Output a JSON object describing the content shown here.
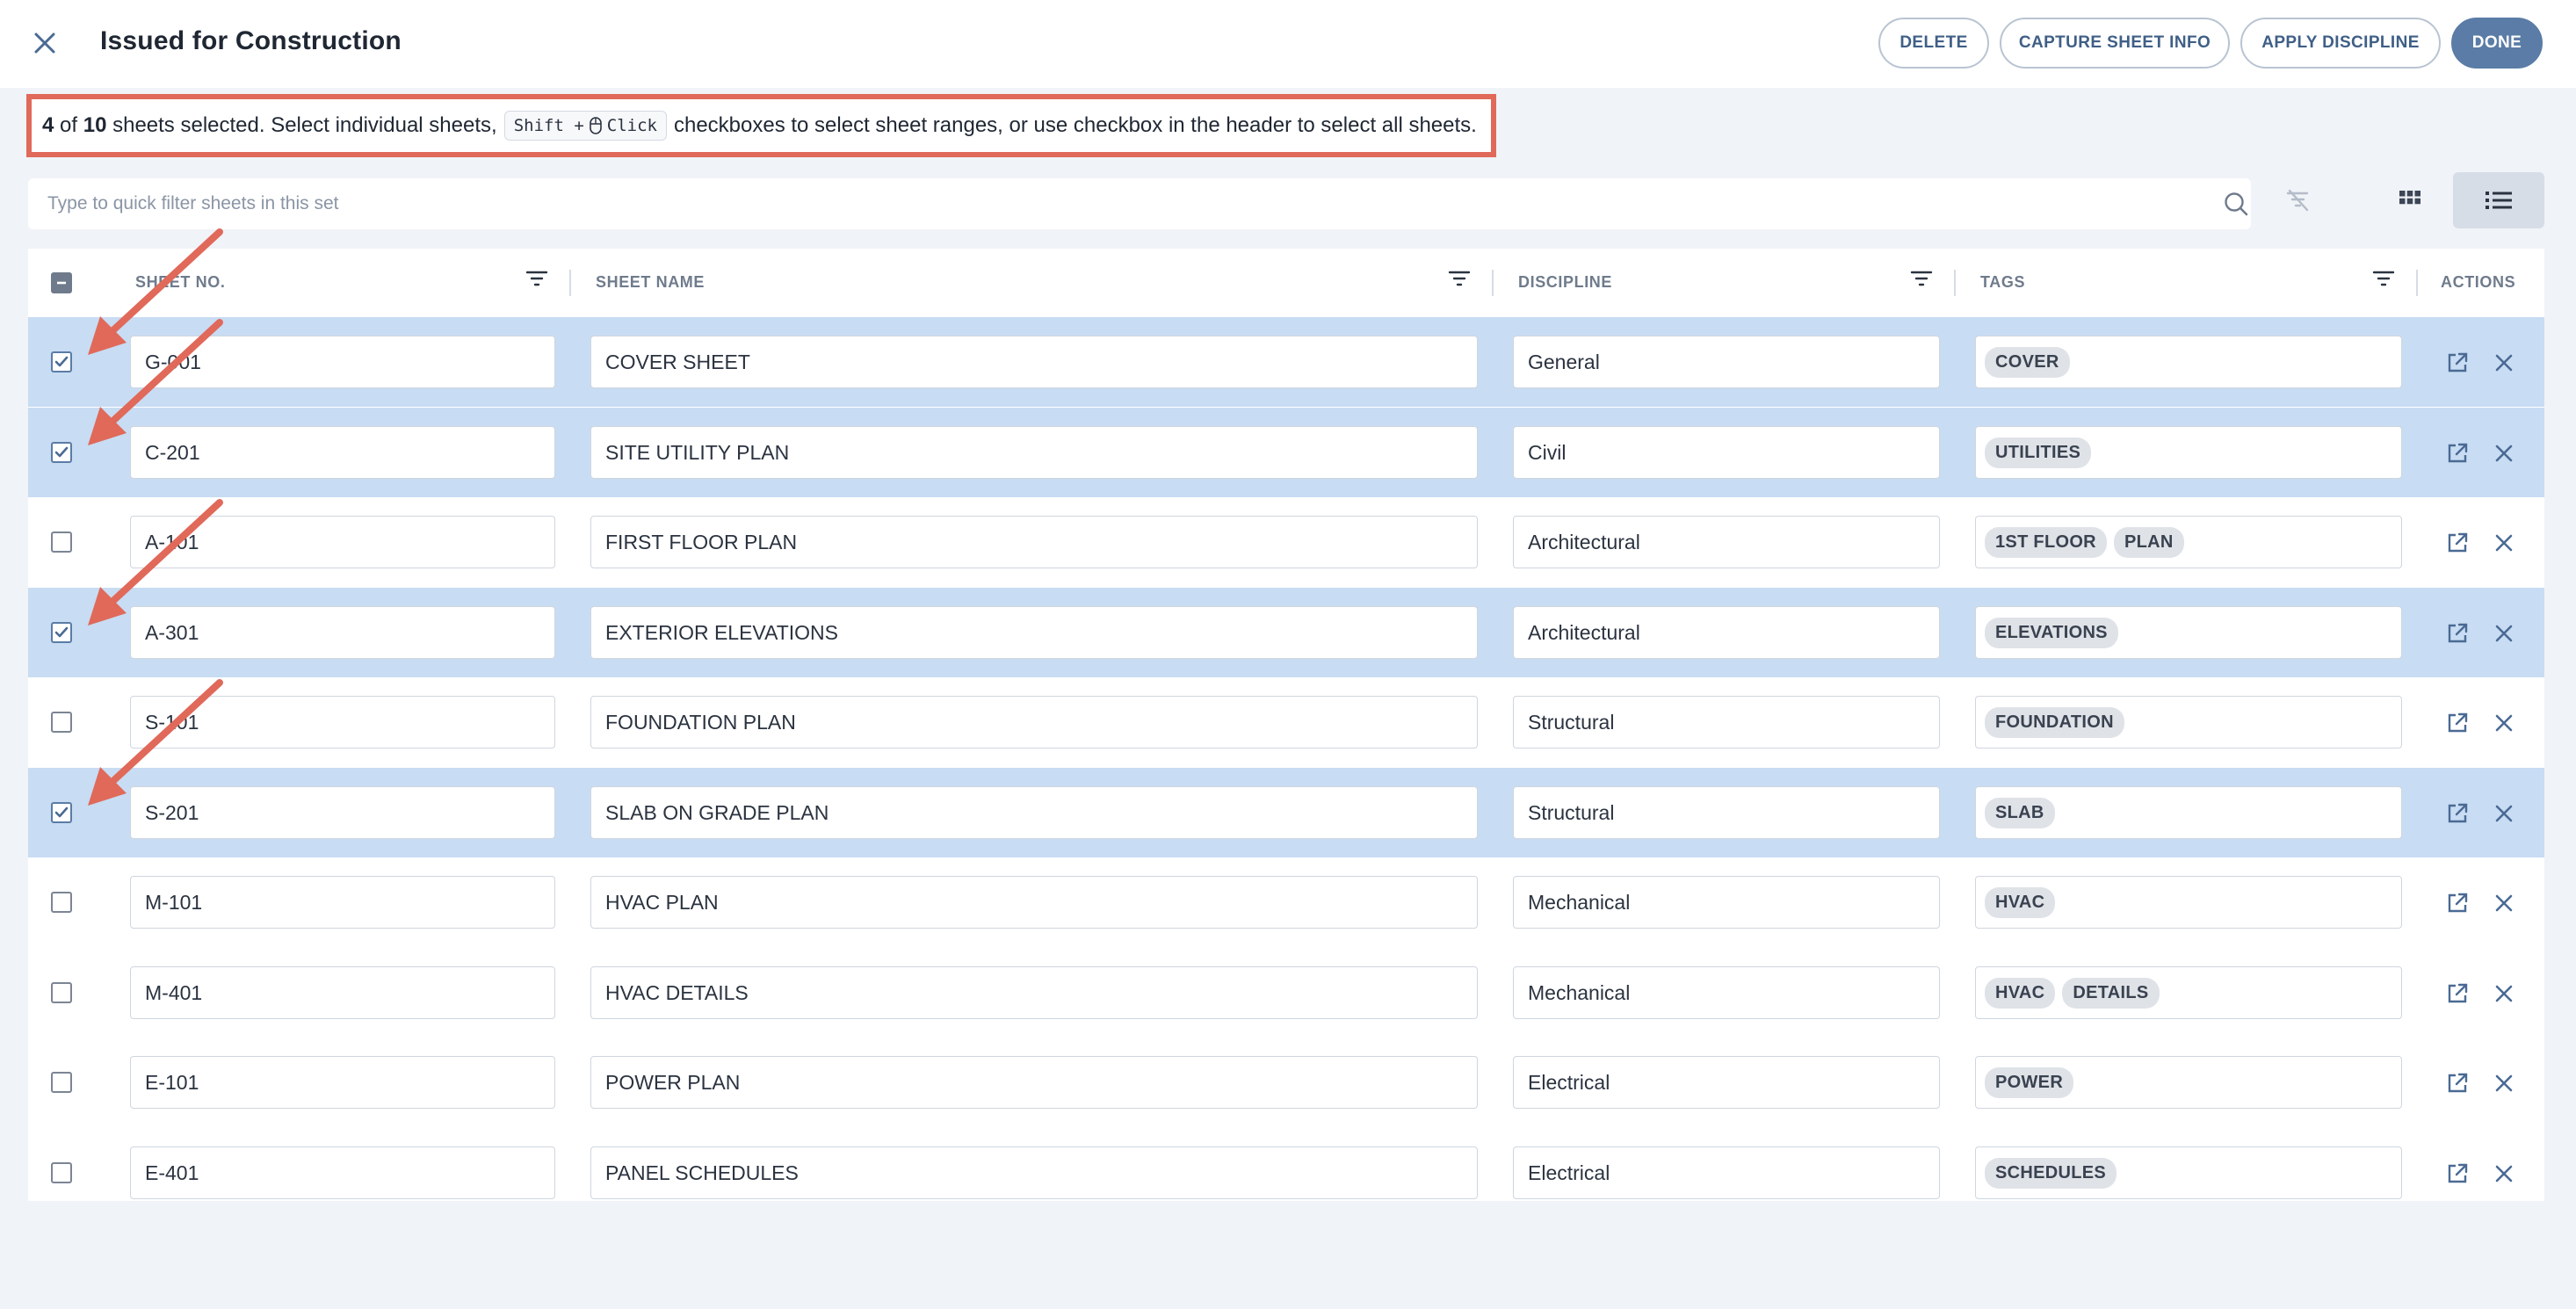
{
  "header": {
    "title": "Issued for Construction",
    "buttons": {
      "delete": "DELETE",
      "capture": "CAPTURE SHEET INFO",
      "apply": "APPLY DISCIPLINE",
      "done": "DONE"
    }
  },
  "info": {
    "selected_count": "4",
    "of_text": "of",
    "total": "10",
    "text_a": "sheets selected. Select individual sheets,",
    "kbd_shift": "Shift +",
    "kbd_click": "Click",
    "text_b": "checkboxes to select sheet ranges, or use checkbox in the header to select all sheets."
  },
  "search": {
    "placeholder": "Type to quick filter sheets in this set"
  },
  "table": {
    "headers": {
      "sheet_no": "SHEET NO.",
      "sheet_name": "SHEET NAME",
      "discipline": "DISCIPLINE",
      "tags": "TAGS",
      "actions": "ACTIONS"
    },
    "rows": [
      {
        "no": "G-001",
        "name": "COVER SHEET",
        "discipline": "General",
        "tags": [
          "COVER"
        ],
        "selected": true
      },
      {
        "no": "C-201",
        "name": "SITE UTILITY PLAN",
        "discipline": "Civil",
        "tags": [
          "UTILITIES"
        ],
        "selected": true
      },
      {
        "no": "A-101",
        "name": "FIRST FLOOR PLAN",
        "discipline": "Architectural",
        "tags": [
          "1ST FLOOR",
          "PLAN"
        ],
        "selected": false
      },
      {
        "no": "A-301",
        "name": "EXTERIOR ELEVATIONS",
        "discipline": "Architectural",
        "tags": [
          "ELEVATIONS"
        ],
        "selected": true
      },
      {
        "no": "S-101",
        "name": "FOUNDATION PLAN",
        "discipline": "Structural",
        "tags": [
          "FOUNDATION"
        ],
        "selected": false
      },
      {
        "no": "S-201",
        "name": "SLAB ON GRADE PLAN",
        "discipline": "Structural",
        "tags": [
          "SLAB"
        ],
        "selected": true
      },
      {
        "no": "M-101",
        "name": "HVAC PLAN",
        "discipline": "Mechanical",
        "tags": [
          "HVAC"
        ],
        "selected": false
      },
      {
        "no": "M-401",
        "name": "HVAC DETAILS",
        "discipline": "Mechanical",
        "tags": [
          "HVAC",
          "DETAILS"
        ],
        "selected": false
      },
      {
        "no": "E-101",
        "name": "POWER PLAN",
        "discipline": "Electrical",
        "tags": [
          "POWER"
        ],
        "selected": false
      },
      {
        "no": "E-401",
        "name": "PANEL SCHEDULES",
        "discipline": "Electrical",
        "tags": [
          "SCHEDULES"
        ],
        "selected": false
      }
    ]
  },
  "colors": {
    "accent": "#5a7ca6",
    "selected_row": "#c8dcf3",
    "annotation": "#e0695a"
  },
  "icons": [
    "close-icon",
    "search-icon",
    "clear-filter-icon",
    "grid-view-icon",
    "list-view-icon",
    "filter-icon",
    "open-external-icon",
    "remove-icon",
    "mouse-icon"
  ]
}
